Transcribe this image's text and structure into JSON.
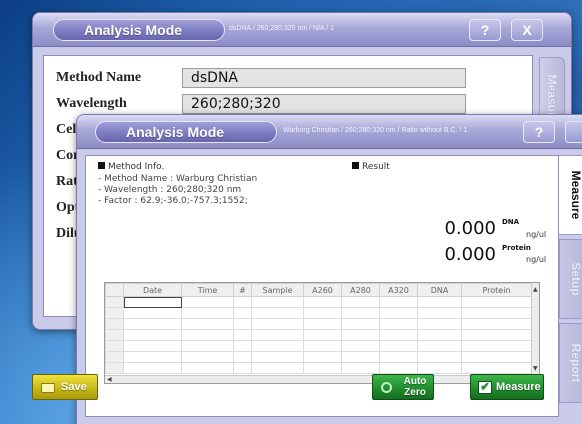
{
  "back_window": {
    "title": "Analysis Mode",
    "info": "dsDNA / 260;280;320 nm / N/A / 1",
    "help_label": "?",
    "close_label": "X",
    "side_tab": "Measure",
    "fields": [
      {
        "label": "Method Name",
        "value": "dsDNA"
      },
      {
        "label": "Wavelength",
        "value": "260;280;320"
      },
      {
        "label": "Cell",
        "value": ""
      },
      {
        "label": "Con",
        "value": ""
      },
      {
        "label": "Rat",
        "value": ""
      },
      {
        "label": "Opt",
        "value": ""
      },
      {
        "label": "Dilu",
        "value": ""
      }
    ]
  },
  "front_window": {
    "title": "Analysis Mode",
    "info": "Warburg Christian / 260;280;320 nm / Ratio without B.C. / 1",
    "help_label": "?",
    "method_info": {
      "heading": "Method Info.",
      "lines": [
        "- Method Name : Warburg Christian",
        "- Wavelength : 260;280;320 nm",
        "- Factor : 62.9;-36.0;-757.3;1552;"
      ]
    },
    "result": {
      "heading": "Result",
      "dna_label": "DNA",
      "dna_value": "0.000",
      "dna_unit": "ng/ul",
      "protein_label": "Protein",
      "protein_value": "0.000",
      "protein_unit": "ng/ul"
    },
    "table": {
      "columns": [
        "Date",
        "Time",
        "#",
        "Sample",
        "A260",
        "A280",
        "A320",
        "DNA",
        "Protein"
      ],
      "rows": [
        [
          "",
          "",
          "",
          "",
          "",
          "",
          "",
          "",
          ""
        ],
        [
          "",
          "",
          "",
          "",
          "",
          "",
          "",
          "",
          ""
        ],
        [
          "",
          "",
          "",
          "",
          "",
          "",
          "",
          "",
          ""
        ],
        [
          "",
          "",
          "",
          "",
          "",
          "",
          "",
          "",
          ""
        ],
        [
          "",
          "",
          "",
          "",
          "",
          "",
          "",
          "",
          ""
        ],
        [
          "",
          "",
          "",
          "",
          "",
          "",
          "",
          "",
          ""
        ],
        [
          "",
          "",
          "",
          "",
          "",
          "",
          "",
          "",
          ""
        ]
      ]
    },
    "tabs": [
      "Measure",
      "Setup",
      "Report"
    ],
    "buttons": {
      "save": "Save",
      "auto_zero": "Auto Zero",
      "measure": "Measure"
    }
  },
  "colors": {
    "desktop": "#2a78c6",
    "window_frame": "#c9cbe9",
    "title_pill": "#7d7cc1",
    "save_button": "#d4c421",
    "green_button": "#1f8a2b"
  }
}
